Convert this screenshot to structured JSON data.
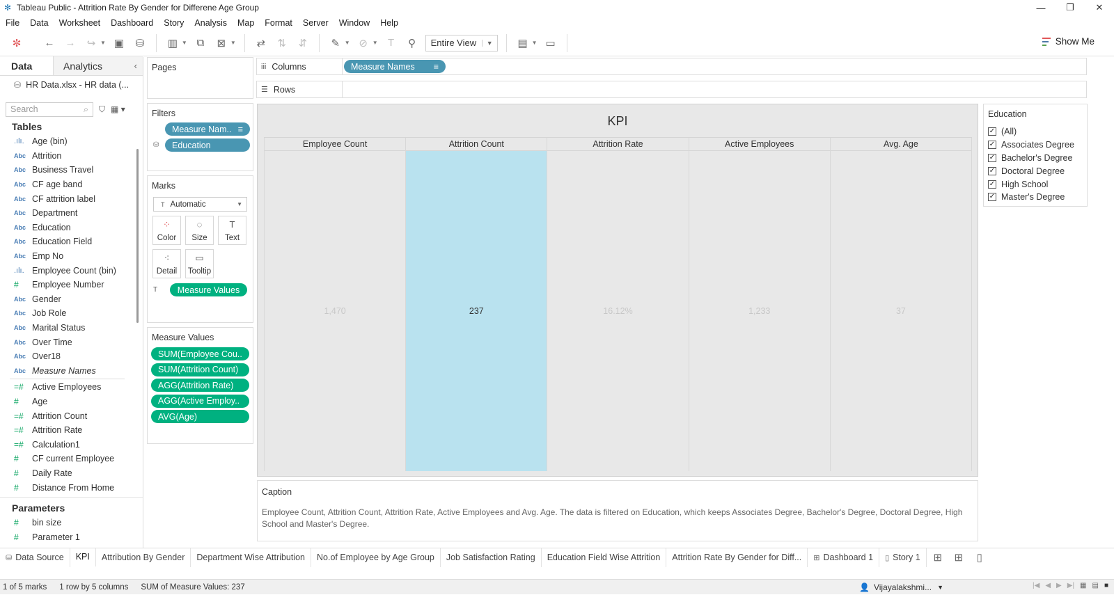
{
  "window": {
    "title": "Tableau Public - Attrition Rate By Gender for Differene Age Group",
    "minimize": "—",
    "restore": "❐",
    "close": "✕"
  },
  "menu": [
    "File",
    "Data",
    "Worksheet",
    "Dashboard",
    "Story",
    "Analysis",
    "Map",
    "Format",
    "Server",
    "Window",
    "Help"
  ],
  "toolbar": {
    "view_mode": "Entire View",
    "show_me": "Show Me"
  },
  "data_pane": {
    "tab_data": "Data",
    "tab_analytics": "Analytics",
    "datasource": "HR Data.xlsx - HR data (...",
    "search_placeholder": "Search",
    "tables_header": "Tables",
    "dimensions": [
      {
        "type": "bin",
        "icon": ".ılı.",
        "name": "Age (bin)"
      },
      {
        "type": "abc",
        "icon": "Abc",
        "name": "Attrition"
      },
      {
        "type": "abc",
        "icon": "Abc",
        "name": "Business Travel"
      },
      {
        "type": "abc",
        "icon": "Abc",
        "name": "CF age band"
      },
      {
        "type": "abc",
        "icon": "Abc",
        "name": "CF attrition label"
      },
      {
        "type": "abc",
        "icon": "Abc",
        "name": "Department"
      },
      {
        "type": "abc",
        "icon": "Abc",
        "name": "Education"
      },
      {
        "type": "abc",
        "icon": "Abc",
        "name": "Education Field"
      },
      {
        "type": "abc",
        "icon": "Abc",
        "name": "Emp No"
      },
      {
        "type": "bin",
        "icon": ".ılı.",
        "name": "Employee Count (bin)"
      },
      {
        "type": "num",
        "icon": "#",
        "name": "Employee Number"
      },
      {
        "type": "abc",
        "icon": "Abc",
        "name": "Gender"
      },
      {
        "type": "abc",
        "icon": "Abc",
        "name": "Job Role"
      },
      {
        "type": "abc",
        "icon": "Abc",
        "name": "Marital Status"
      },
      {
        "type": "abc",
        "icon": "Abc",
        "name": "Over Time"
      },
      {
        "type": "abc",
        "icon": "Abc",
        "name": "Over18"
      },
      {
        "type": "abc-italic",
        "icon": "Abc",
        "name": "Measure Names"
      }
    ],
    "measures": [
      {
        "icon": "=#",
        "name": "Active Employees"
      },
      {
        "icon": "#",
        "name": "Age"
      },
      {
        "icon": "=#",
        "name": "Attrition Count"
      },
      {
        "icon": "=#",
        "name": "Attrition Rate"
      },
      {
        "icon": "=#",
        "name": "Calculation1"
      },
      {
        "icon": "#",
        "name": "CF current Employee"
      },
      {
        "icon": "#",
        "name": "Daily Rate"
      },
      {
        "icon": "#",
        "name": "Distance From Home"
      }
    ],
    "parameters_header": "Parameters",
    "parameters": [
      {
        "icon": "#",
        "name": "bin size"
      },
      {
        "icon": "#",
        "name": "Parameter 1"
      }
    ]
  },
  "cards": {
    "pages": "Pages",
    "filters": "Filters",
    "filter_pills": [
      "Measure Nam..",
      "Education"
    ],
    "marks": "Marks",
    "marks_type": "Automatic",
    "mark_buttons": [
      {
        "label": "Color",
        "icon": "⁘"
      },
      {
        "label": "Size",
        "icon": "◌"
      },
      {
        "label": "Text",
        "icon": "T"
      },
      {
        "label": "Detail",
        "icon": "⁖"
      },
      {
        "label": "Tooltip",
        "icon": "▭"
      }
    ],
    "marks_pill": "Measure Values",
    "measure_values": "Measure Values",
    "measure_value_pills": [
      "SUM(Employee Cou..",
      "SUM(Attrition Count)",
      "AGG(Attrition Rate)",
      "AGG(Active Employ..",
      "AVG(Age)"
    ]
  },
  "shelves": {
    "columns": "Columns",
    "rows": "Rows",
    "columns_pill": "Measure Names"
  },
  "viz": {
    "title": "KPI",
    "columns": [
      {
        "header": "Employee Count",
        "value": "1,470",
        "selected": false
      },
      {
        "header": "Attrition Count",
        "value": "237",
        "selected": true
      },
      {
        "header": "Attrition Rate",
        "value": "16.12%",
        "selected": false
      },
      {
        "header": "Active Employees",
        "value": "1,233",
        "selected": false
      },
      {
        "header": "Avg. Age",
        "value": "37",
        "selected": false
      }
    ],
    "highlight_color": "#b9e2ef"
  },
  "caption": {
    "header": "Caption",
    "text": "Employee Count, Attrition Count, Attrition Rate, Active Employees and Avg. Age.  The data is filtered on Education, which keeps Associates Degree, Bachelor's Degree, Doctoral Degree, High School and Master's Degree."
  },
  "legend": {
    "header": "Education",
    "items": [
      "(All)",
      "Associates Degree",
      "Bachelor's Degree",
      "Doctoral Degree",
      "High School",
      "Master's Degree"
    ]
  },
  "sheet_tabs": [
    {
      "label": "Data Source",
      "icon": "⛁"
    },
    {
      "label": "KPI",
      "icon": "",
      "active": true
    },
    {
      "label": "Attribution By Gender",
      "icon": ""
    },
    {
      "label": "Department Wise Attribution",
      "icon": ""
    },
    {
      "label": "No.of Employee by Age Group",
      "icon": ""
    },
    {
      "label": "Job Satisfaction Rating",
      "icon": ""
    },
    {
      "label": "Education Field Wise Attrition",
      "icon": ""
    },
    {
      "label": "Attrition Rate By Gender for Diff...",
      "icon": ""
    },
    {
      "label": "Dashboard 1",
      "icon": "⊞"
    },
    {
      "label": "Story 1",
      "icon": "▯"
    }
  ],
  "status": {
    "marks": "1 of 5 marks",
    "dims": "1 row by 5 columns",
    "sum": "SUM of Measure Values: 237",
    "user": "Vijayalakshmi..."
  },
  "colors": {
    "blue_pill": "#4996b2",
    "green_pill": "#00b180"
  }
}
